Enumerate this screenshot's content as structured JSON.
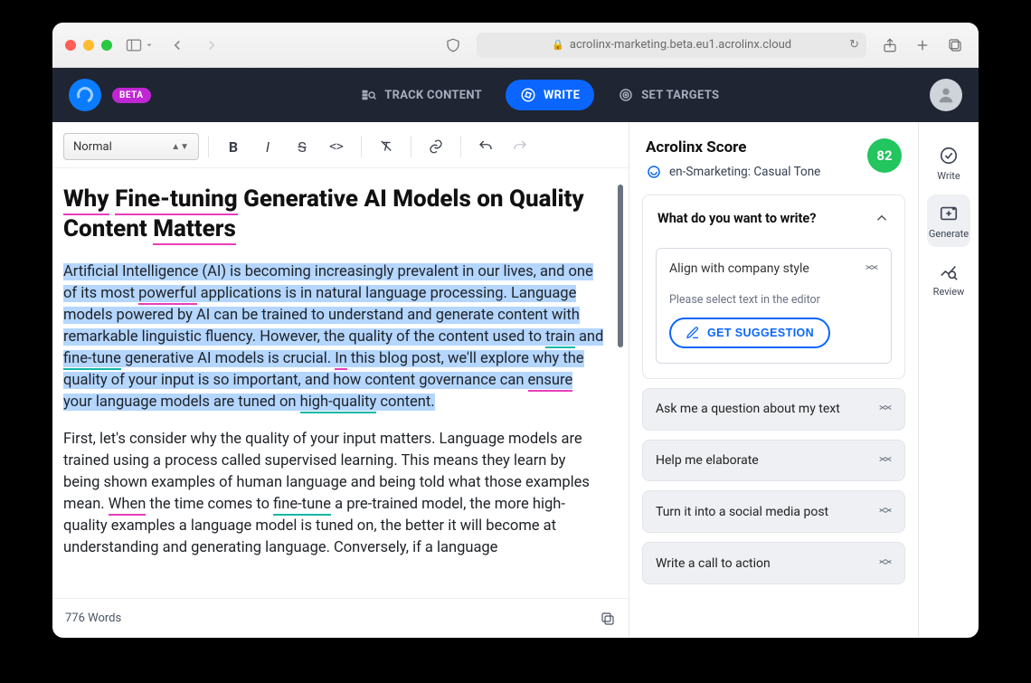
{
  "browser": {
    "url": "acrolinx-marketing.beta.eu1.acrolinx.cloud"
  },
  "header": {
    "badge": "BETA",
    "tabs": {
      "track": "TRACK CONTENT",
      "write": "WRITE",
      "targets": "SET TARGETS"
    }
  },
  "toolbar": {
    "style": "Normal"
  },
  "document": {
    "title_plain": "Why Fine-tuning Generative AI Models on Quality Content Matters",
    "para1_plain": "Artificial Intelligence (AI) is becoming increasingly prevalent in our lives, and one of its most powerful applications is in natural language processing. Language models powered by AI can be trained to understand and generate content with remarkable linguistic fluency. However, the quality of the content used to train and fine-tune generative AI models is crucial. In this blog post, we'll explore why the quality of your input is so important, and how content governance can ensure your language models are tuned on high-quality content.",
    "para2_plain": "First, let's consider why the quality of your input matters. Language models are trained using a process called supervised learning. This means they learn by being shown examples of human language and being told what those examples mean. When the time comes to fine-tune a pre-trained model, the more high-quality examples a language model is tuned on, the better it will become at understanding and generating language. Conversely, if a language",
    "word_count": "776 Words"
  },
  "score": {
    "title": "Acrolinx Score",
    "tone": "en-Smarketing: Casual Tone",
    "value": "82"
  },
  "panel": {
    "prompt": "What do you want to write?",
    "option": "Align with company style",
    "hint": "Please select text in the editor",
    "cta": "GET SUGGESTION"
  },
  "suggestions": {
    "s1": "Ask me a question about my text",
    "s2": "Help me elaborate",
    "s3": "Turn it into a social media post",
    "s4": "Write a call to action"
  },
  "rail": {
    "write": "Write",
    "generate": "Generate",
    "review": "Review"
  }
}
